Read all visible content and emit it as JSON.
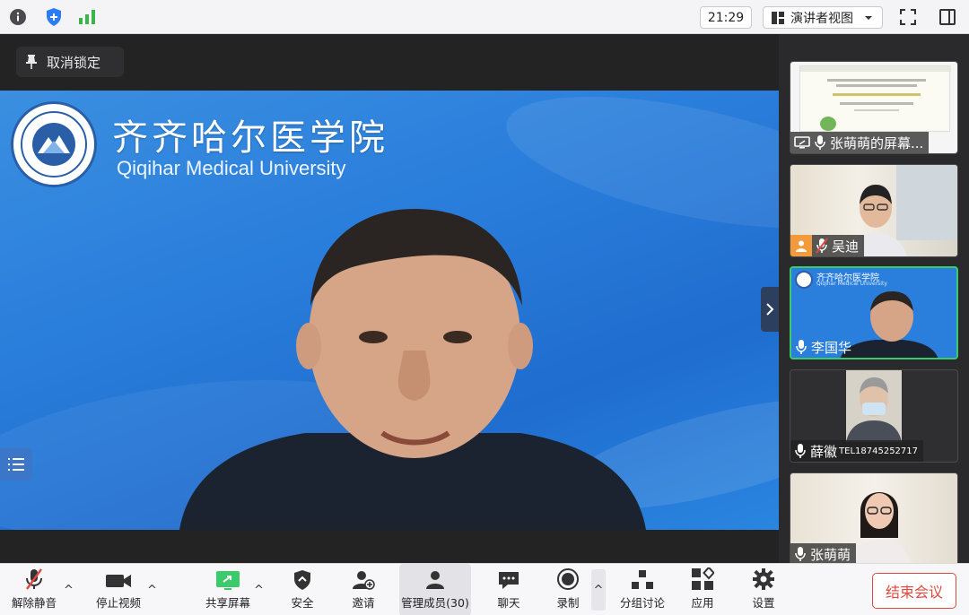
{
  "topbar": {
    "time": "21:29",
    "view_mode": "演讲者视图",
    "icons": [
      "info-icon",
      "shield-icon",
      "signal-icon",
      "speaker-view-icon",
      "chevron-down-icon",
      "fullscreen-icon",
      "sidebar-toggle-icon"
    ]
  },
  "stage": {
    "unpin_label": "取消锁定",
    "main_speaker": "李国华",
    "background": {
      "university_cn": "齐齐哈尔医学院",
      "university_en": "Qiqihar Medical University"
    }
  },
  "gallery": {
    "participants": [
      {
        "name": "张萌萌的屏幕...",
        "type": "screen-share"
      },
      {
        "name": "吴迪",
        "type": "video",
        "mic": "muted"
      },
      {
        "name": "李国华",
        "type": "video",
        "mic": "on",
        "active": true
      },
      {
        "name": "薛徽",
        "tel": "TEL18745252717",
        "type": "video",
        "mic": "on"
      },
      {
        "name": "张萌萌",
        "type": "video",
        "mic": "on"
      }
    ]
  },
  "toolbar": {
    "unmute": "解除静音",
    "stop_video": "停止视频",
    "share_screen": "共享屏幕",
    "security": "安全",
    "invite": "邀请",
    "manage_members": "管理成员(30)",
    "chat": "聊天",
    "record": "录制",
    "breakout": "分组讨论",
    "apps": "应用",
    "settings": "设置",
    "end_meeting": "结束会议"
  },
  "colors": {
    "accent_green": "#3ccb6a",
    "end_red": "#e0483e",
    "stage_blue": "#2b7fdc"
  }
}
